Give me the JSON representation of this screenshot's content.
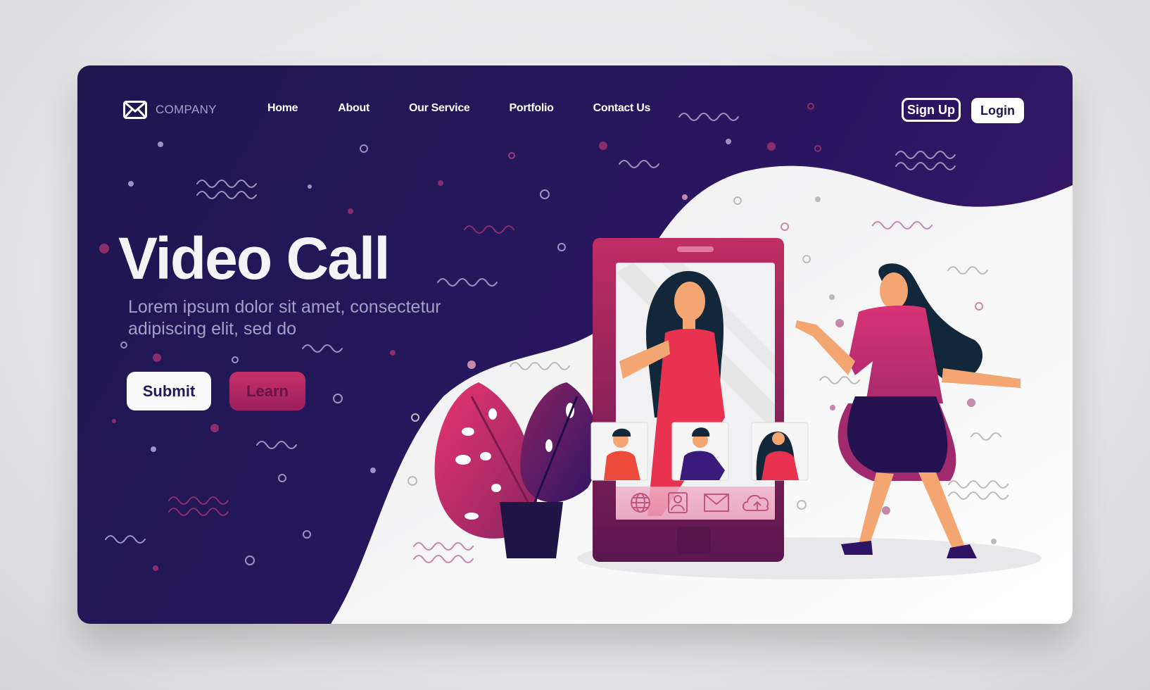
{
  "brand": {
    "name": "COMPANY",
    "icon": "envelope-icon"
  },
  "nav": {
    "links": [
      {
        "label": "Home"
      },
      {
        "label": "About"
      },
      {
        "label": "Our Service"
      },
      {
        "label": "Portfolio"
      },
      {
        "label": "Contact Us"
      }
    ],
    "signup_label": "Sign Up",
    "login_label": "Login"
  },
  "hero": {
    "title": "Video Call",
    "subtitle": "Lorem ipsum dolor sit amet, consectetur adipiscing elit, sed do",
    "submit_label": "Submit",
    "learn_label": "Learn"
  },
  "phone": {
    "dock_icons": [
      "globe-icon",
      "contact-icon",
      "mail-icon",
      "cloud-upload-icon"
    ],
    "participants": [
      "man-orange-shirt",
      "man-purple-shirt",
      "woman-red-shirt"
    ]
  },
  "colors": {
    "background_dark": "#24175a",
    "accent_pink": "#c8306a",
    "light": "#f4f4f6",
    "muted_text": "#a59fc6"
  }
}
